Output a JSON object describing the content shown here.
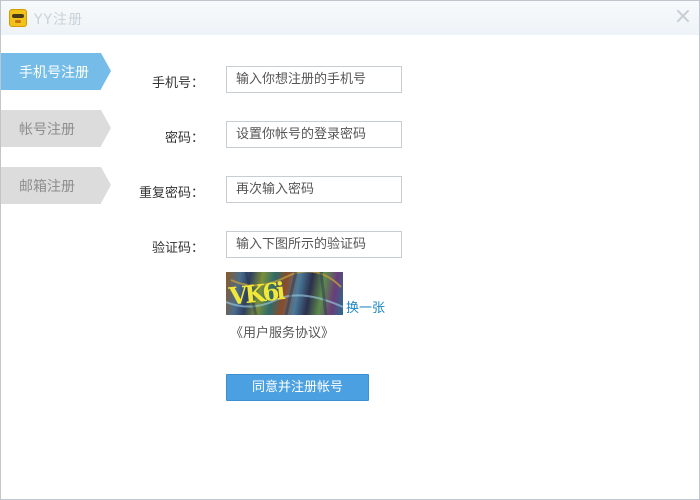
{
  "window": {
    "title": "YY注册",
    "icon": "yy-logo-icon",
    "close_icon": "close-icon"
  },
  "tabs": [
    {
      "label": "手机号注册",
      "active": true
    },
    {
      "label": "帐号注册",
      "active": false
    },
    {
      "label": "邮箱注册",
      "active": false
    }
  ],
  "form": {
    "phone": {
      "label": "手机号：",
      "placeholder": "输入你想注册的手机号",
      "value": ""
    },
    "password": {
      "label": "密码：",
      "placeholder": "设置你帐号的登录密码",
      "value": ""
    },
    "confirm_password": {
      "label": "重复密码：",
      "placeholder": "再次输入密码",
      "value": ""
    },
    "captcha": {
      "label": "验证码：",
      "placeholder": "输入下图所示的验证码",
      "value": ""
    }
  },
  "captcha_image": {
    "text": "VK6i",
    "refresh_label": "换一张"
  },
  "agreement_link": "《用户服务协议》",
  "submit_button": "同意并注册帐号",
  "colors": {
    "active_tab": "#75bde8",
    "inactive_tab": "#dcdcdc",
    "primary_button": "#4aa0e0",
    "link": "#1d84c6"
  }
}
